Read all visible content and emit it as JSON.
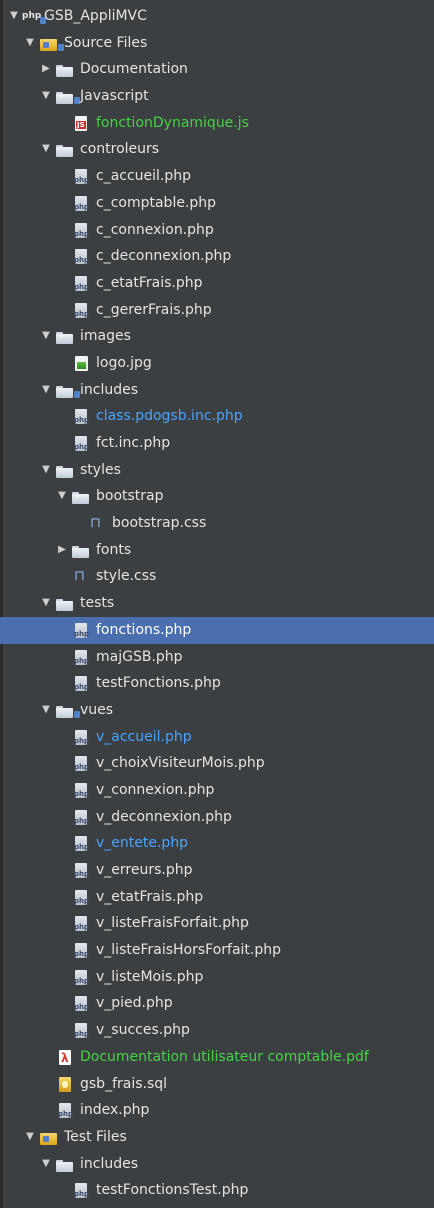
{
  "tree": {
    "items": [
      {
        "label": "GSB_AppliMVC",
        "depth": 0,
        "toggle": "▼",
        "icon": "php-project-icon",
        "badge": true,
        "color": "white"
      },
      {
        "label": "Source Files",
        "depth": 1,
        "toggle": "▼",
        "icon": "pkg-folder-icon",
        "badge": true,
        "color": "white"
      },
      {
        "label": "Documentation",
        "depth": 2,
        "toggle": "▶",
        "icon": "folder-icon",
        "color": "white"
      },
      {
        "label": "Javascript",
        "depth": 2,
        "toggle": "▼",
        "icon": "folder-icon",
        "badge": true,
        "color": "white"
      },
      {
        "label": "fonctionDynamique.js",
        "depth": 3,
        "toggle": "",
        "icon": "js-icon",
        "color": "green"
      },
      {
        "label": "controleurs",
        "depth": 2,
        "toggle": "▼",
        "icon": "folder-icon",
        "color": "white"
      },
      {
        "label": "c_accueil.php",
        "depth": 3,
        "toggle": "",
        "icon": "php-icon",
        "color": "white"
      },
      {
        "label": "c_comptable.php",
        "depth": 3,
        "toggle": "",
        "icon": "php-icon",
        "color": "white"
      },
      {
        "label": "c_connexion.php",
        "depth": 3,
        "toggle": "",
        "icon": "php-icon",
        "color": "white"
      },
      {
        "label": "c_deconnexion.php",
        "depth": 3,
        "toggle": "",
        "icon": "php-icon",
        "color": "white"
      },
      {
        "label": "c_etatFrais.php",
        "depth": 3,
        "toggle": "",
        "icon": "php-icon",
        "color": "white"
      },
      {
        "label": "c_gererFrais.php",
        "depth": 3,
        "toggle": "",
        "icon": "php-icon",
        "color": "white"
      },
      {
        "label": "images",
        "depth": 2,
        "toggle": "▼",
        "icon": "folder-icon",
        "color": "white"
      },
      {
        "label": "logo.jpg",
        "depth": 3,
        "toggle": "",
        "icon": "image-icon",
        "color": "white"
      },
      {
        "label": "includes",
        "depth": 2,
        "toggle": "▼",
        "icon": "folder-icon",
        "badge": true,
        "color": "white"
      },
      {
        "label": "class.pdogsb.inc.php",
        "depth": 3,
        "toggle": "",
        "icon": "php-icon",
        "color": "blue"
      },
      {
        "label": "fct.inc.php",
        "depth": 3,
        "toggle": "",
        "icon": "php-icon",
        "color": "white"
      },
      {
        "label": "styles",
        "depth": 2,
        "toggle": "▼",
        "icon": "folder-icon",
        "color": "white"
      },
      {
        "label": "bootstrap",
        "depth": 3,
        "toggle": "▼",
        "icon": "folder-icon",
        "color": "white"
      },
      {
        "label": "bootstrap.css",
        "depth": 4,
        "toggle": "",
        "icon": "css-icon",
        "color": "white"
      },
      {
        "label": "fonts",
        "depth": 3,
        "toggle": "▶",
        "icon": "folder-icon",
        "color": "white"
      },
      {
        "label": "style.css",
        "depth": 3,
        "toggle": "",
        "icon": "css-icon",
        "color": "white"
      },
      {
        "label": "tests",
        "depth": 2,
        "toggle": "▼",
        "icon": "folder-icon",
        "color": "white"
      },
      {
        "label": "fonctions.php",
        "depth": 3,
        "toggle": "",
        "icon": "php-icon",
        "color": "white",
        "selected": true
      },
      {
        "label": "majGSB.php",
        "depth": 3,
        "toggle": "",
        "icon": "php-icon",
        "color": "white"
      },
      {
        "label": "testFonctions.php",
        "depth": 3,
        "toggle": "",
        "icon": "php-icon",
        "color": "white"
      },
      {
        "label": "vues",
        "depth": 2,
        "toggle": "▼",
        "icon": "folder-icon",
        "badge": true,
        "color": "white"
      },
      {
        "label": "v_accueil.php",
        "depth": 3,
        "toggle": "",
        "icon": "php-icon",
        "color": "blue"
      },
      {
        "label": "v_choixVisiteurMois.php",
        "depth": 3,
        "toggle": "",
        "icon": "php-icon",
        "color": "white"
      },
      {
        "label": "v_connexion.php",
        "depth": 3,
        "toggle": "",
        "icon": "php-icon",
        "color": "white"
      },
      {
        "label": "v_deconnexion.php",
        "depth": 3,
        "toggle": "",
        "icon": "php-icon",
        "color": "white"
      },
      {
        "label": "v_entete.php",
        "depth": 3,
        "toggle": "",
        "icon": "php-icon",
        "color": "blue"
      },
      {
        "label": "v_erreurs.php",
        "depth": 3,
        "toggle": "",
        "icon": "php-icon",
        "color": "white"
      },
      {
        "label": "v_etatFrais.php",
        "depth": 3,
        "toggle": "",
        "icon": "php-icon",
        "color": "white"
      },
      {
        "label": "v_listeFraisForfait.php",
        "depth": 3,
        "toggle": "",
        "icon": "php-icon",
        "color": "white"
      },
      {
        "label": "v_listeFraisHorsForfait.php",
        "depth": 3,
        "toggle": "",
        "icon": "php-icon",
        "color": "white"
      },
      {
        "label": "v_listeMois.php",
        "depth": 3,
        "toggle": "",
        "icon": "php-icon",
        "color": "white"
      },
      {
        "label": "v_pied.php",
        "depth": 3,
        "toggle": "",
        "icon": "php-icon",
        "color": "white"
      },
      {
        "label": "v_succes.php",
        "depth": 3,
        "toggle": "",
        "icon": "php-icon",
        "color": "white"
      },
      {
        "label": "Documentation utilisateur comptable.pdf",
        "depth": 2,
        "toggle": "",
        "icon": "pdf-icon",
        "color": "green"
      },
      {
        "label": "gsb_frais.sql",
        "depth": 2,
        "toggle": "",
        "icon": "sql-icon",
        "color": "white"
      },
      {
        "label": "index.php",
        "depth": 2,
        "toggle": "",
        "icon": "php-icon",
        "color": "white"
      },
      {
        "label": "Test Files",
        "depth": 1,
        "toggle": "▼",
        "icon": "pkg-folder-icon",
        "color": "white"
      },
      {
        "label": "includes",
        "depth": 2,
        "toggle": "▼",
        "icon": "folder-icon",
        "color": "white"
      },
      {
        "label": "testFonctionsTest.php",
        "depth": 3,
        "toggle": "",
        "icon": "php-icon",
        "color": "white"
      }
    ]
  }
}
